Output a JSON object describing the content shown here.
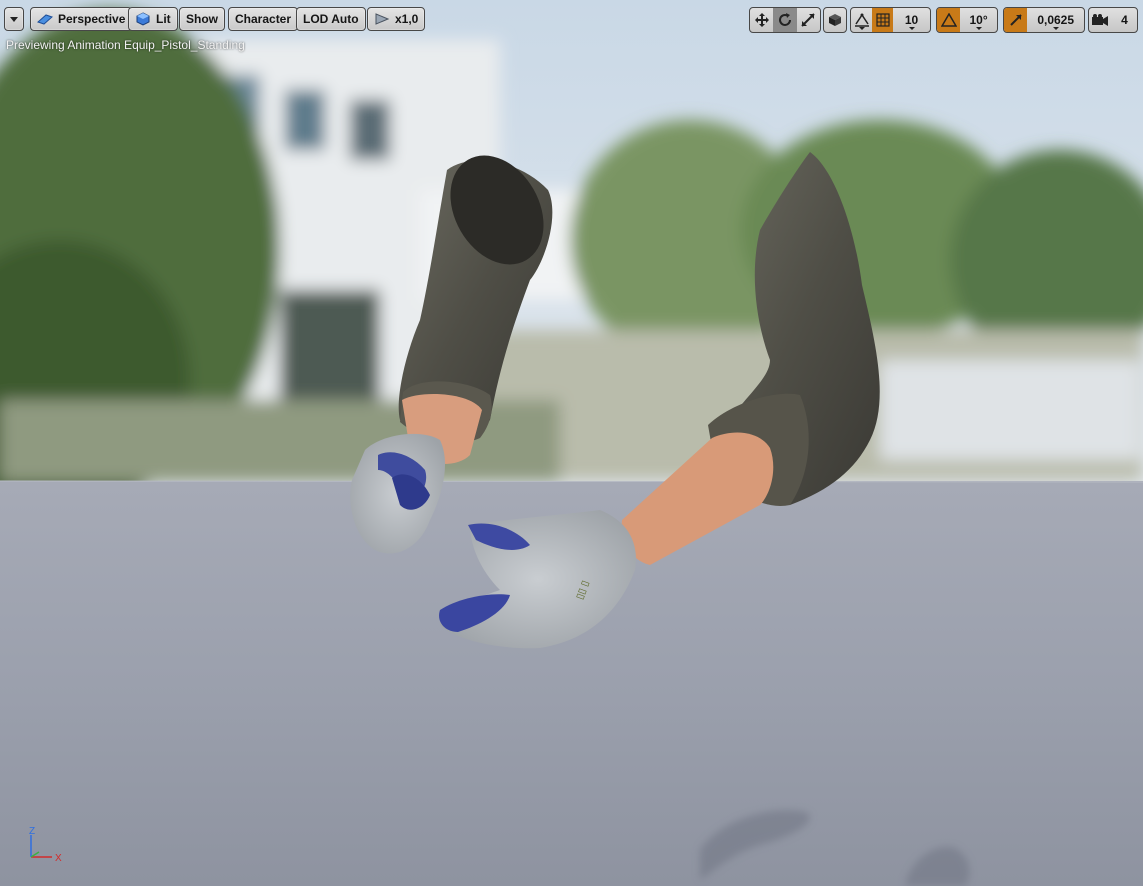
{
  "toolbar": {
    "menu_icon": "chevron-down-icon",
    "perspective_label": "Perspective",
    "lit_label": "Lit",
    "show_label": "Show",
    "character_label": "Character",
    "lod_label": "LOD Auto",
    "speed_label": "x1,0"
  },
  "right_toolbar": {
    "transform_tools": [
      "translate-icon",
      "rotate-icon",
      "scale-icon"
    ],
    "active_tool": "rotate-icon",
    "grid_snap_value": "10",
    "rotation_snap_value": "10°",
    "scale_snap_value": "0,0625",
    "camera_speed_value": "4"
  },
  "viewport": {
    "preview_text": "Previewing Animation Equip_Pistol_Standing",
    "axis_z": "Z",
    "axis_x": "X"
  },
  "colors": {
    "snap_active": "#c87a18",
    "axis_x": "#d32b2b",
    "axis_y": "#3cb043",
    "axis_z": "#2f6fe0"
  }
}
